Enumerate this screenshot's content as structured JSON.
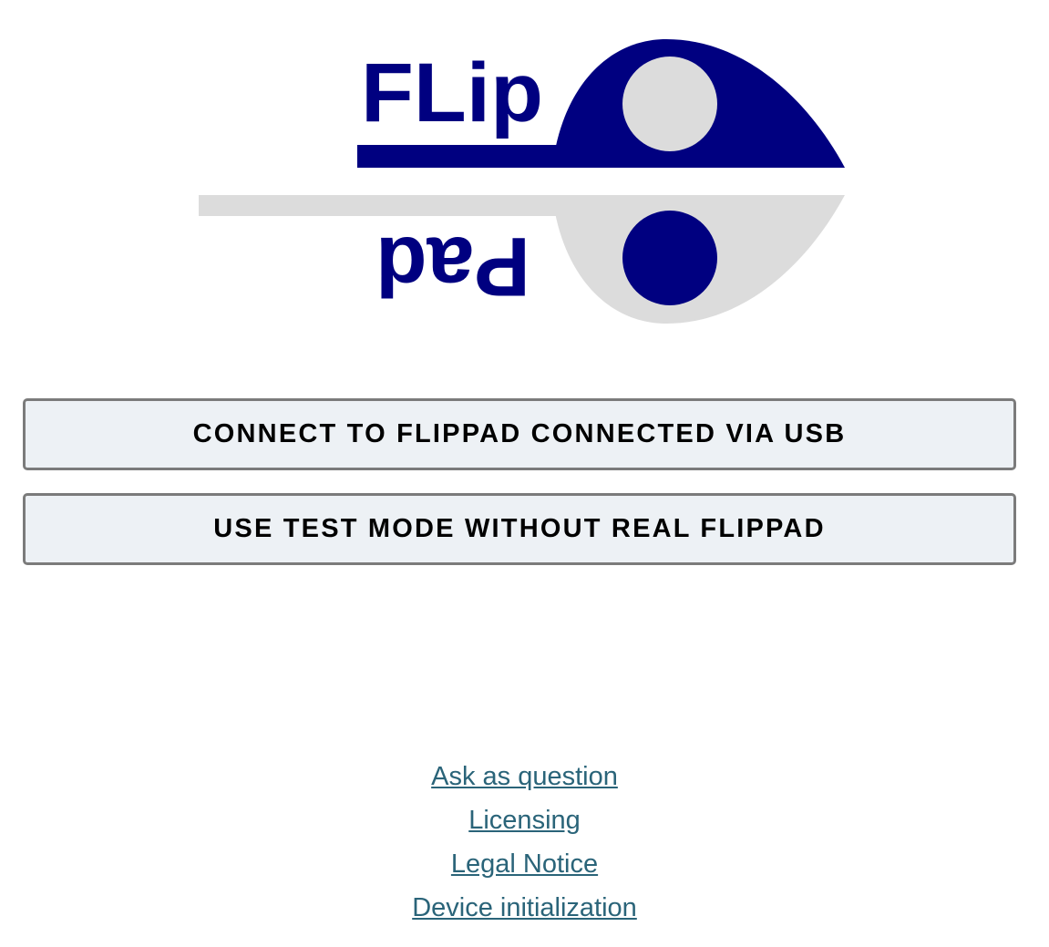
{
  "logo": {
    "top_text": "FLip",
    "bottom_text": "Pad",
    "primary_color": "#000080",
    "secondary_color": "#dcdcdc"
  },
  "buttons": {
    "connect_usb_label": "CONNECT TO FLIPPAD CONNECTED VIA USB",
    "test_mode_label": "USE TEST MODE WITHOUT REAL FLIPPAD"
  },
  "footer": {
    "links": [
      {
        "label": "Ask as question"
      },
      {
        "label": "Licensing"
      },
      {
        "label": "Legal Notice"
      },
      {
        "label": "Device initialization"
      }
    ],
    "link_color": "#2a6479"
  },
  "colors": {
    "button_bg": "#edf1f5",
    "button_border": "#7b7b7b"
  }
}
